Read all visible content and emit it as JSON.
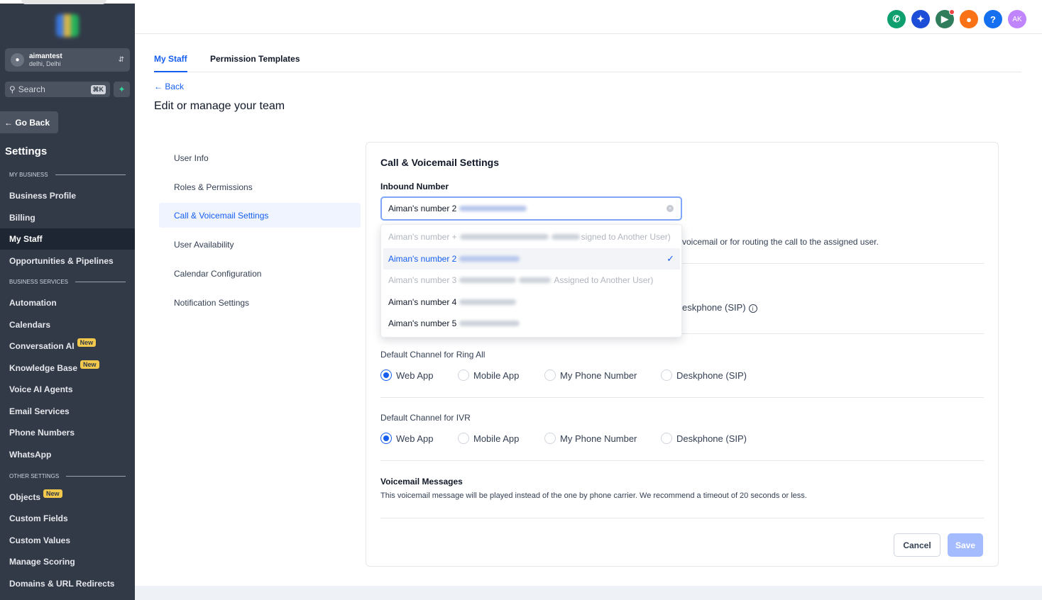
{
  "sidebar": {
    "account_name": "aimantest",
    "account_location": "delhi, Delhi",
    "search_placeholder": "Search",
    "search_shortcut": "⌘K",
    "go_back": "← Go Back",
    "title": "Settings",
    "section_my_business": "MY BUSINESS",
    "section_business_services": "BUSINESS SERVICES",
    "section_other_settings": "OTHER SETTINGS",
    "items": [
      "Business Profile",
      "Billing",
      "My Staff",
      "Opportunities & Pipelines",
      "Automation",
      "Calendars",
      "Conversation AI",
      "Knowledge Base",
      "Voice AI Agents",
      "Email Services",
      "Phone Numbers",
      "WhatsApp",
      "Objects",
      "Custom Fields",
      "Custom Values",
      "Manage Scoring",
      "Domains & URL Redirects"
    ],
    "badge_new": "New"
  },
  "header": {
    "avatar_initials": "AK",
    "help": "?",
    "colors": {
      "phone": "#0e9f6e",
      "ai": "#1d4ed8",
      "announce": "#2f7d5a",
      "bell": "#f97316",
      "help": "#1570ef",
      "avatar": "#c084fc"
    }
  },
  "tabs": [
    "My Staff",
    "Permission Templates"
  ],
  "back_label": "← Back",
  "page_title": "Edit or manage your team",
  "left_menu": [
    "User Info",
    "Roles & Permissions",
    "Call & Voicemail Settings",
    "User Availability",
    "Calendar Configuration",
    "Notification Settings"
  ],
  "card": {
    "title": "Call & Voicemail Settings",
    "inbound_label": "Inbound Number",
    "inbound_value": "Aiman's number 2",
    "hint_partial": "voicemail or for routing the call to the assigned user.",
    "hidden_option_partial": "eskphone (SIP)",
    "ring_all_label": "Default Channel for Ring All",
    "ivr_label": "Default Channel for IVR",
    "channel_options": [
      "Web App",
      "Mobile App",
      "My Phone Number",
      "Deskphone (SIP)"
    ],
    "ring_all_selected": "Web App",
    "ivr_selected": "Web App",
    "voicemail_title": "Voicemail Messages",
    "voicemail_desc": "This voicemail message will be played instead of the one by phone carrier. We recommend a timeout of 20 seconds or less.",
    "cancel": "Cancel",
    "save": "Save"
  },
  "dropdown": {
    "options": [
      {
        "prefix": "Aiman's number +",
        "suffix": "signed to Another User)",
        "disabled": true
      },
      {
        "prefix": "Aiman's number 2",
        "suffix": "",
        "selected": true
      },
      {
        "prefix": "Aiman's number 3",
        "suffix": "Assigned to Another User)",
        "disabled": true
      },
      {
        "prefix": "Aiman's number 4",
        "suffix": ""
      },
      {
        "prefix": "Aiman's number 5",
        "suffix": ""
      }
    ]
  }
}
